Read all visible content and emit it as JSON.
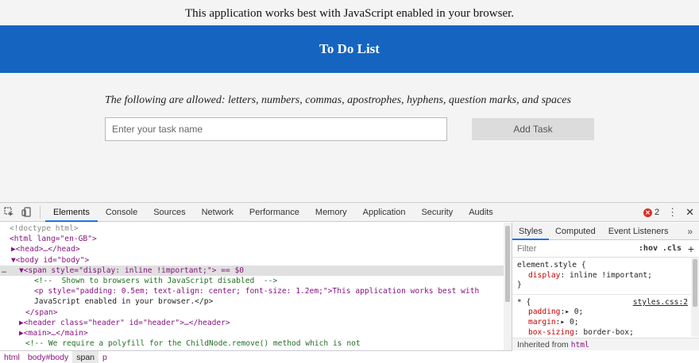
{
  "page": {
    "noscript_text": "This application works best with JavaScript enabled in your browser.",
    "header_title": "To Do List",
    "allowed_text": "The following are allowed: letters, numbers, commas, apostrophes, hyphens, question marks, and spaces",
    "task_input_placeholder": "Enter your task name",
    "task_input_value": "",
    "add_button_label": "Add Task",
    "header_color": "#1565c0"
  },
  "devtools": {
    "tabs": [
      "Elements",
      "Console",
      "Sources",
      "Network",
      "Performance",
      "Memory",
      "Application",
      "Security",
      "Audits"
    ],
    "active_tab": "Elements",
    "error_count": "2",
    "dom": [
      "<!doctype html>",
      "<html lang=\"en-GB\">",
      "▶<head>…</head>",
      "▼<body id=\"body\">",
      "▼<span style=\"display: inline !important;\"> == $0",
      "<!--  Shown to browsers with JavaScript disabled  -->",
      "<p style=\"padding: 0.5em; text-align: center; font-size: 1.2em;\">This application works best with",
      "JavaScript enabled in your browser.</p>",
      "</span>",
      "▶<header class=\"header\" id=\"header\">…</header>",
      "▶<main>…</main>",
      "<!-- We require a polyfill for the ChildNode.remove() method which is not"
    ],
    "styles_tabs": [
      "Styles",
      "Computed",
      "Event Listeners"
    ],
    "styles_more": "»",
    "filter_placeholder": "Filter",
    "hov_label": ":hov",
    "cls_label": ".cls",
    "plus_label": "+",
    "rule1": {
      "selector": "element.style {",
      "prop": "display",
      "value": ": inline !important;",
      "close": "}"
    },
    "rule2": {
      "selector": "* {",
      "source": "styles.css:2",
      "props": [
        {
          "name": "padding",
          "value": ":▸ 0;"
        },
        {
          "name": "margin",
          "value": ":▸ 0;"
        },
        {
          "name": "box-sizing",
          "value": ": border-box;"
        }
      ],
      "close": "}"
    },
    "inherited_label": "Inherited from",
    "inherited_tag": "html",
    "breadcrumbs": [
      "html",
      "body#body",
      "span",
      "p"
    ],
    "breadcrumb_active": "span"
  }
}
